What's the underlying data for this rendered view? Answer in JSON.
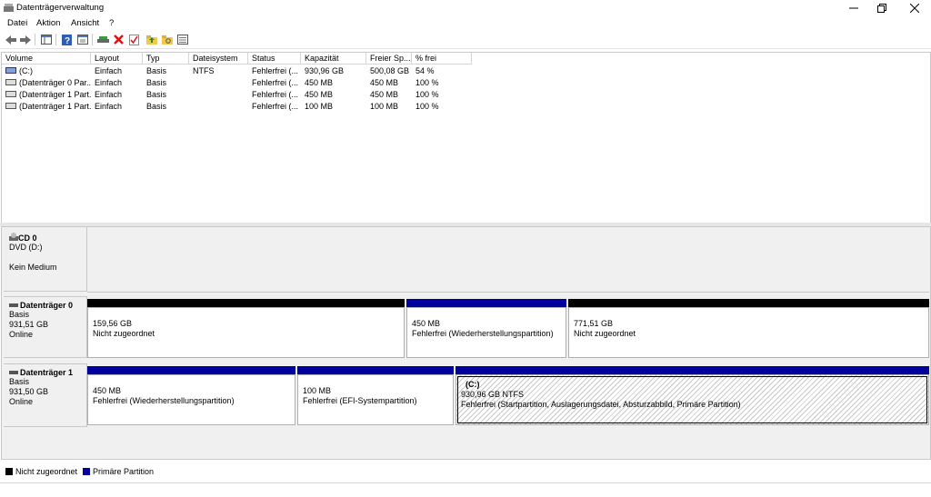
{
  "window": {
    "title": "Datenträgerverwaltung"
  },
  "menu": [
    "Datei",
    "Aktion",
    "Ansicht",
    "?"
  ],
  "toolbar_icons": [
    "back-arrow-icon",
    "forward-arrow-icon",
    "console-tree-icon",
    "help-icon",
    "properties-icon",
    "connect-icon",
    "delete-icon",
    "check-icon",
    "folder-up-icon",
    "folder-search-icon",
    "view-icon"
  ],
  "table": {
    "columns": [
      "Volume",
      "Layout",
      "Typ",
      "Dateisystem",
      "Status",
      "Kapazität",
      "Freier Sp...",
      "% frei"
    ],
    "rows": [
      [
        "(C:)",
        "Einfach",
        "Basis",
        "NTFS",
        "Fehlerfrei (...",
        "930,96 GB",
        "500,08 GB",
        "54 %"
      ],
      [
        "(Datenträger 0 Par...",
        "Einfach",
        "Basis",
        "",
        "Fehlerfrei (...",
        "450 MB",
        "450 MB",
        "100 %"
      ],
      [
        "(Datenträger 1 Part...",
        "Einfach",
        "Basis",
        "",
        "Fehlerfrei (...",
        "450 MB",
        "450 MB",
        "100 %"
      ],
      [
        "(Datenträger 1 Part...",
        "Einfach",
        "Basis",
        "",
        "Fehlerfrei (...",
        "100 MB",
        "100 MB",
        "100 %"
      ]
    ]
  },
  "disks": {
    "cd0": {
      "name": "CD 0",
      "line1": "DVD (D:)",
      "line2": "Kein Medium"
    },
    "disk0": {
      "name": "Datenträger 0",
      "type": "Basis",
      "size": "931,51 GB",
      "status": "Online",
      "partitions": [
        {
          "size": "159,56 GB",
          "desc": "Nicht zugeordnet"
        },
        {
          "size": "450 MB",
          "desc": "Fehlerfrei (Wiederherstellungspartition)"
        },
        {
          "size": "771,51 GB",
          "desc": "Nicht zugeordnet"
        }
      ]
    },
    "disk1": {
      "name": "Datenträger 1",
      "type": "Basis",
      "size": "931,50 GB",
      "status": "Online",
      "partitions": [
        {
          "size": "450 MB",
          "desc": "Fehlerfrei (Wiederherstellungspartition)"
        },
        {
          "size": "100 MB",
          "desc": "Fehlerfrei (EFI-Systempartition)"
        },
        {
          "label": "(C:)",
          "size": "930,96 GB NTFS",
          "desc": "Fehlerfrei (Startpartition, Auslagerungsdatei, Absturzabbild, Primäre Partition)"
        }
      ]
    }
  },
  "legend": {
    "unallocated": "Nicht zugeordnet",
    "primary": "Primäre Partition"
  },
  "colors": {
    "unallocated": "#000000",
    "primary": "#00009c"
  }
}
